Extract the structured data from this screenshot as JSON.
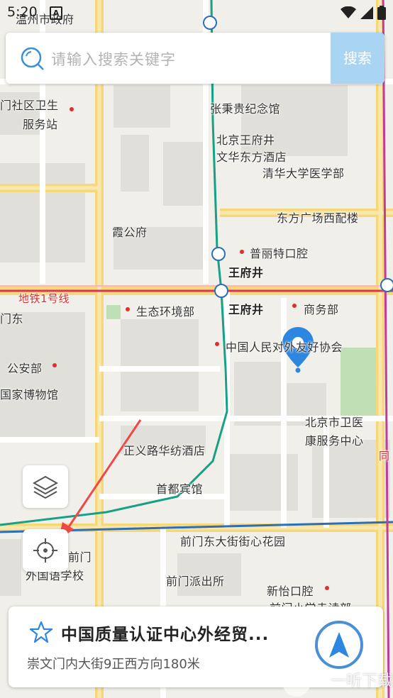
{
  "status_bar": {
    "time": "5:20",
    "badge": "A"
  },
  "search": {
    "placeholder": "请输入搜索关键字",
    "button_label": "搜索"
  },
  "map": {
    "labels": {
      "top_left_gov": "温州市政府",
      "community_health": "门社区卫生",
      "service_station": "服务站",
      "zhang_memorial": "张秉贵纪念馆",
      "hotel_line1": "北京王府井",
      "hotel_line2": "文华东方酒店",
      "tsinghua_med": "清华大学医学部",
      "oriental_plaza": "东方广场西配楼",
      "xiagongfu": "霞公府",
      "puli_dental": "普丽特口腔",
      "wangfujing_1": "王府井",
      "metro_line1": "地铁1号线",
      "left_edge_dong": "门东",
      "ecology_ministry": "生态环境部",
      "wangfujing_2": "王府井",
      "commerce_ministry": "商务部",
      "friendship_assoc": "中国人民对外友好协会",
      "public_security": "公安部",
      "national_museum": "国家博物馆",
      "beijing_health_1": "北京市卫医",
      "beijing_health_2": "康服务中心",
      "zhengyilu_hotel": "正义路华纺酒店",
      "capital_hotel": "首都宾馆",
      "qianmen_garden": "前门东大街街心花园",
      "qianmen_1": "前门",
      "foreign_lang_school": "外国语学校",
      "qianmen_police": "前门派出所",
      "xinyi_dental": "新怡口腔",
      "qianmen_primary": "前门小学走读部",
      "right_edge": "同"
    }
  },
  "info_card": {
    "title": "中国质量认证中心外经贸...",
    "subtitle": "崇文门内大街9正西方向180米"
  },
  "watermark": "一听下载"
}
